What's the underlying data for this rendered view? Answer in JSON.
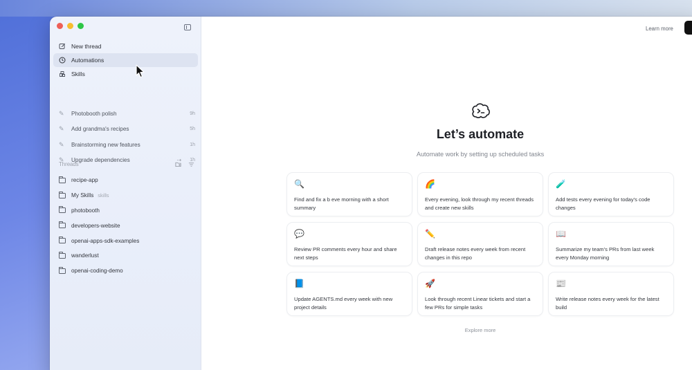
{
  "sidebar": {
    "nav": [
      {
        "label": "New thread",
        "icon": "edit-icon"
      },
      {
        "label": "Automations",
        "icon": "clock-icon"
      },
      {
        "label": "Skills",
        "icon": "skills-icon"
      }
    ],
    "pinned": [
      {
        "label": "Photobooth polish",
        "time": "9h"
      },
      {
        "label": "Add grandma's recipes",
        "time": "5h"
      },
      {
        "label": "Brainstorming new features",
        "time": "1h"
      },
      {
        "label": "Upgrade dependencies",
        "time": "1h",
        "branch": "⇢"
      }
    ],
    "threads_label": "Threads",
    "threads": [
      {
        "label": "recipe-app",
        "tag": ""
      },
      {
        "label": "My Skills",
        "tag": "skills"
      },
      {
        "label": "photobooth",
        "tag": ""
      },
      {
        "label": "developers-website",
        "tag": ""
      },
      {
        "label": "openai-apps-sdk-examples",
        "tag": ""
      },
      {
        "label": "wanderlust",
        "tag": ""
      },
      {
        "label": "openai-coding-demo",
        "tag": ""
      }
    ]
  },
  "header": {
    "learn_more": "Learn more"
  },
  "main": {
    "title": "Let’s automate",
    "subtitle": "Automate work by setting up scheduled tasks",
    "cards": [
      {
        "emoji": "🔍",
        "text": "Find and fix a b    eve    morning with a short summary"
      },
      {
        "emoji": "🌈",
        "text": "Every evening, look through my recent threads and create new skills"
      },
      {
        "emoji": "🧪",
        "text": "Add tests every evening for today's code changes"
      },
      {
        "emoji": "💬",
        "text": "Review PR comments every hour and share next steps"
      },
      {
        "emoji": "✏️",
        "text": "Draft release notes every week from recent changes in this repo"
      },
      {
        "emoji": "📖",
        "text": "Summarize my team's PRs from last week every Monday morning"
      },
      {
        "emoji": "📘",
        "text": "Update AGENTS.md every week with new project details"
      },
      {
        "emoji": "🚀",
        "text": "Look through recent Linear tickets and start a few PRs for simple tasks"
      },
      {
        "emoji": "📰",
        "text": "Write release notes every week for the latest build"
      }
    ],
    "explore_more": "Explore more"
  }
}
